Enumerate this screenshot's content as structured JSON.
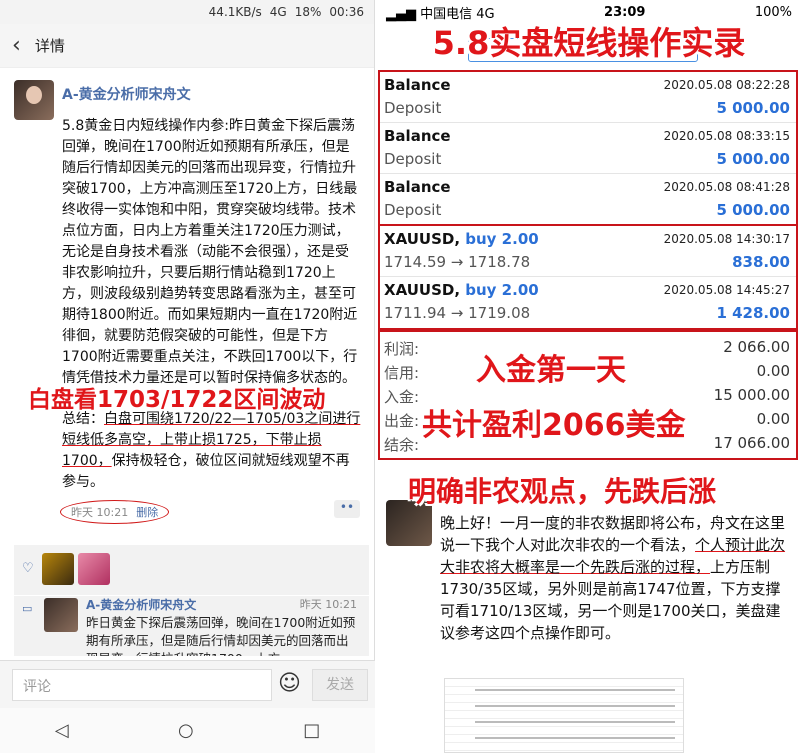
{
  "left": {
    "status": {
      "speed": "44.1KB/s",
      "network": "4G",
      "battery": "18%",
      "time": "00:36"
    },
    "header": {
      "title": "详情"
    },
    "post": {
      "author": "A-黄金分析师宋舟文",
      "text": "5.8黄金日内短线操作内参:昨日黄金下探后震荡回弹，晚间在1700附近如预期有所承压，但是随后行情却因美元的回落而出现异变，行情拉升突破1700，上方冲高测压至1720上方，日线最终收得一实体饱和中阳，贯穿突破均线带。技术点位方面，日内上方着重关注1720压力测试，无论是自身技术看涨（动能不会很强），还是受非农影响拉升，只要后期行情站稳到1720上方，则波段级别趋势转变思路看涨为主，甚至可期待1800附近。而如果短期内一直在1720附近徘徊，就要防范假突破的可能性，但是下方1700附近需要重点关注，不跌回1700以下，行情凭借技术力量还是可以暂时保持偏多状态的。",
      "summary_label": "总结：",
      "summary_underlined": "白盘可围绕1720/22—1705/03之间进行短线低多高空，上带止损1725，下带止损1700，",
      "summary_rest": "保持极轻仓，破位区间就短线观望不再参与。",
      "overlay": "白盘看1703/1722区间波动",
      "time": "昨天 10:21",
      "delete": "删除",
      "more": "••"
    },
    "comment": {
      "author": "A-黄金分析师宋舟文",
      "time": "昨天 10:21",
      "text": "昨日黄金下探后震荡回弹，晚间在1700附近如预期有所承压，但是随后行情却因美元的回落而出现异变，行情拉升突破1700，上方"
    },
    "input": {
      "placeholder": "评论",
      "send": "发送"
    }
  },
  "right": {
    "status": {
      "carrier": "中国电信",
      "network": "4G",
      "time": "23:09",
      "battery": "100%"
    },
    "title": "5.8实盘短线操作实录",
    "deposits": [
      {
        "label": "Balance",
        "date": "2020.05.08 08:22:28",
        "sub": "Deposit",
        "amount": "5 000.00"
      },
      {
        "label": "Balance",
        "date": "2020.05.08 08:33:15",
        "sub": "Deposit",
        "amount": "5 000.00"
      },
      {
        "label": "Balance",
        "date": "2020.05.08 08:41:28",
        "sub": "Deposit",
        "amount": "5 000.00"
      }
    ],
    "trades": [
      {
        "symbol": "XAUUSD,",
        "side": "buy 2.00",
        "date": "2020.05.08 14:30:17",
        "prices": "1714.59 → 1718.78",
        "profit": "838.00"
      },
      {
        "symbol": "XAUUSD,",
        "side": "buy 2.00",
        "date": "2020.05.08 14:45:27",
        "prices": "1711.94 → 1719.08",
        "profit": "1 428.00"
      }
    ],
    "summary": [
      {
        "label": "利润:",
        "value": "2 066.00"
      },
      {
        "label": "信用:",
        "value": "0.00"
      },
      {
        "label": "入金:",
        "value": "15 000.00"
      },
      {
        "label": "出金:",
        "value": "0.00"
      },
      {
        "label": "结余:",
        "value": "17 066.00"
      }
    ],
    "overlay1": "入金第一天",
    "overlay2": "共计盈利2066美金",
    "overlay3": "明确非农观点，先跌后涨",
    "comment": {
      "text_before": "晚上好！一月一度的非农数据即将公布，舟文在这里说一下我个人对此次非农的一个看法，",
      "text_underlined": "个人预计此次大非农将大概率是一个先跌后涨的过程，",
      "text_after": "上方压制1730/35区域，另外则是前高1747位置，下方支撑可看1710/13区域，另一个则是1700关口，美盘建议参考这四个点操作即可。"
    }
  }
}
